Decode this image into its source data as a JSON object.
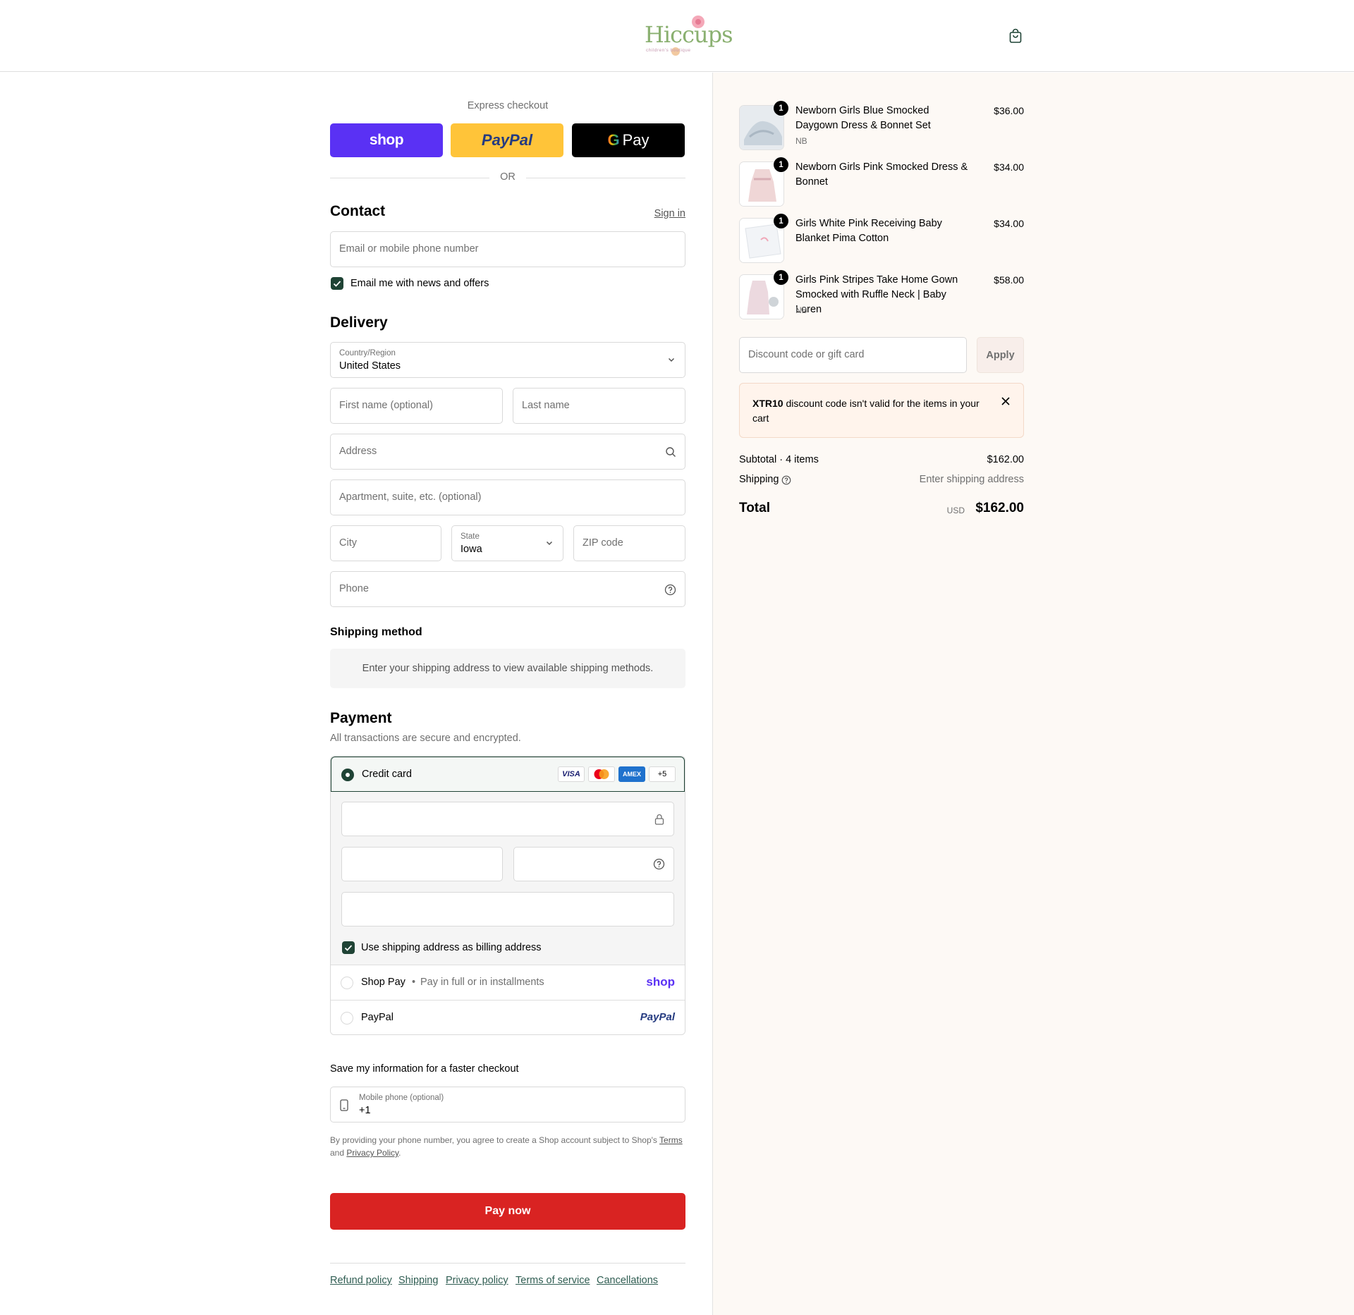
{
  "brand": {
    "logo_text": "Hiccups",
    "logo_sub": "children's boutique"
  },
  "express": {
    "title": "Express checkout",
    "shop_label": "shop",
    "paypal_label": "PayPal",
    "gpay_label": "Pay",
    "or_label": "OR"
  },
  "contact": {
    "title": "Contact",
    "sign_in": "Sign in",
    "email_placeholder": "Email or mobile phone number",
    "newsletter_label": "Email me with news and offers",
    "newsletter_checked": true
  },
  "delivery": {
    "title": "Delivery",
    "country_label": "Country/Region",
    "country_value": "United States",
    "first_name_placeholder": "First name (optional)",
    "last_name_placeholder": "Last name",
    "address_placeholder": "Address",
    "apartment_placeholder": "Apartment, suite, etc. (optional)",
    "city_placeholder": "City",
    "state_label": "State",
    "state_value": "Iowa",
    "zip_placeholder": "ZIP code",
    "phone_placeholder": "Phone"
  },
  "shipping_method": {
    "title": "Shipping method",
    "message": "Enter your shipping address to view available shipping methods."
  },
  "payment": {
    "title": "Payment",
    "subtitle": "All transactions are secure and encrypted.",
    "credit_card_label": "Credit card",
    "card_brands": [
      "VISA",
      "Mastercard",
      "AMEX",
      "+5"
    ],
    "billing_same_label": "Use shipping address as billing address",
    "shop_pay_label": "Shop Pay",
    "shop_pay_detail": "Pay in full or in installments",
    "shop_pay_logo": "shop",
    "paypal_label": "PayPal",
    "paypal_logo": "PayPal"
  },
  "save_info": {
    "title": "Save my information for a faster checkout",
    "mobile_label": "Mobile phone (optional)",
    "mobile_value": "+1",
    "legal_text_1": "By providing your phone number, you agree to create a Shop account subject to Shop's",
    "terms_link": "Terms",
    "legal_and": "and",
    "privacy_link": "Privacy Policy",
    "legal_end": "."
  },
  "pay_now": "Pay now",
  "footer_links": [
    "Refund policy",
    "Shipping",
    "Privacy policy",
    "Terms of service",
    "Cancellations"
  ],
  "cart": {
    "items": [
      {
        "name": "Newborn Girls Blue Smocked Daygown Dress & Bonnet Set",
        "variant": "NB",
        "price": "$36.00",
        "qty": "1"
      },
      {
        "name": "Newborn Girls Pink Smocked Dress & Bonnet",
        "variant": "",
        "price": "$34.00",
        "qty": "1"
      },
      {
        "name": "Girls White Pink Receiving Baby Blanket Pima Cotton",
        "variant": "",
        "price": "$34.00",
        "qty": "1"
      },
      {
        "name": "Girls Pink Stripes Take Home Gown Smocked with Ruffle Neck | Baby Loren",
        "variant": "NB",
        "price": "$58.00",
        "qty": "1"
      }
    ],
    "discount_placeholder": "Discount code or gift card",
    "apply_label": "Apply",
    "error_code": "XTR10",
    "error_message": "discount code isn't valid for the items in your cart",
    "subtotal_label": "Subtotal · 4 items",
    "subtotal_value": "$162.00",
    "shipping_label": "Shipping",
    "shipping_value": "Enter shipping address",
    "total_label": "Total",
    "currency": "USD",
    "total_value": "$162.00"
  },
  "colors": {
    "accent": "#1f4335",
    "pay_button": "#d92322",
    "shop_purple": "#5a31f4",
    "paypal_yellow": "#ffc439",
    "right_bg": "#fdf9f5"
  }
}
